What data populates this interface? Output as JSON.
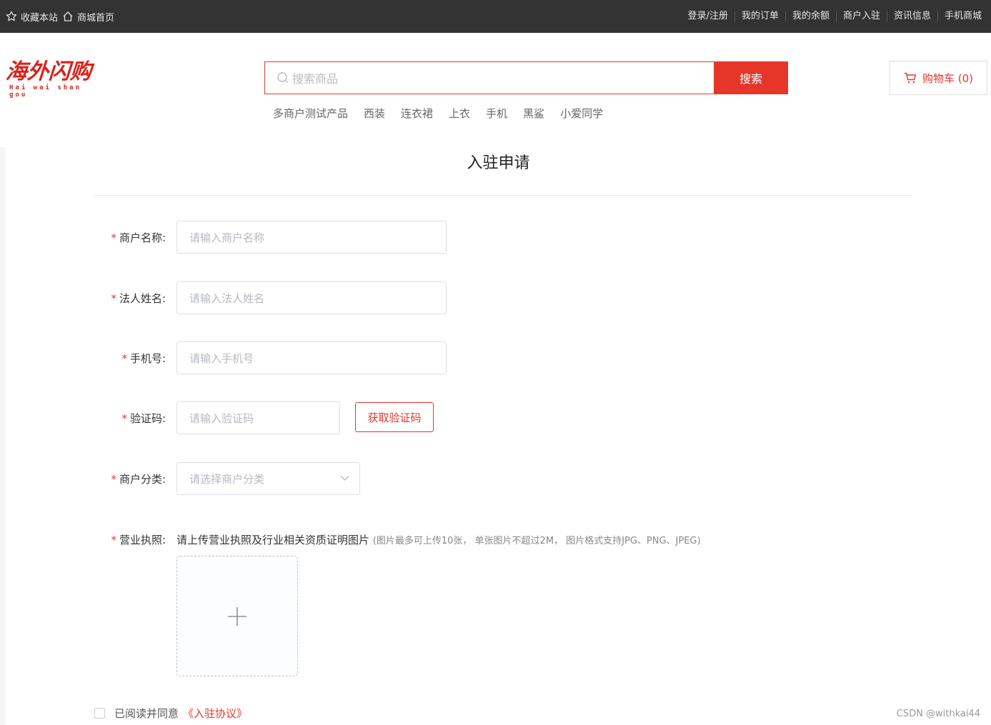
{
  "topbar": {
    "favorite": "收藏本站",
    "home": "商城首页",
    "links": [
      "登录/注册",
      "我的订单",
      "我的余额",
      "商户入驻",
      "资讯信息",
      "手机商城"
    ]
  },
  "header": {
    "logo_main": "海外闪购",
    "logo_sub": "Hai wai shan gou",
    "search_placeholder": "搜索商品",
    "search_button": "搜索",
    "hot_words": [
      "多商户测试产品",
      "西装",
      "连衣裙",
      "上衣",
      "手机",
      "黑鲨",
      "小爱同学"
    ],
    "cart_label": "购物车 (0)"
  },
  "form": {
    "title": "入驻申请",
    "required_mark": "*",
    "merchant_name": {
      "label": "商户名称:",
      "placeholder": "请输入商户名称"
    },
    "legal_name": {
      "label": "法人姓名:",
      "placeholder": "请输入法人姓名"
    },
    "phone": {
      "label": "手机号:",
      "placeholder": "请输入手机号"
    },
    "code": {
      "label": "验证码:",
      "placeholder": "请输入验证码",
      "button": "获取验证码"
    },
    "category": {
      "label": "商户分类:",
      "placeholder": "请选择商户分类"
    },
    "license": {
      "label": "营业执照:",
      "hint": "请上传营业执照及行业相关资质证明图片",
      "hint_small": "(图片最多可上传10张， 单张图片不超过2M， 图片格式支持JPG、PNG、JPEG)"
    },
    "agree_text": "已阅读并同意",
    "agree_link": "《入驻协议》"
  },
  "watermark": "CSDN @withkai44",
  "colors": {
    "accent": "#e6362a",
    "topbar": "#333333"
  }
}
